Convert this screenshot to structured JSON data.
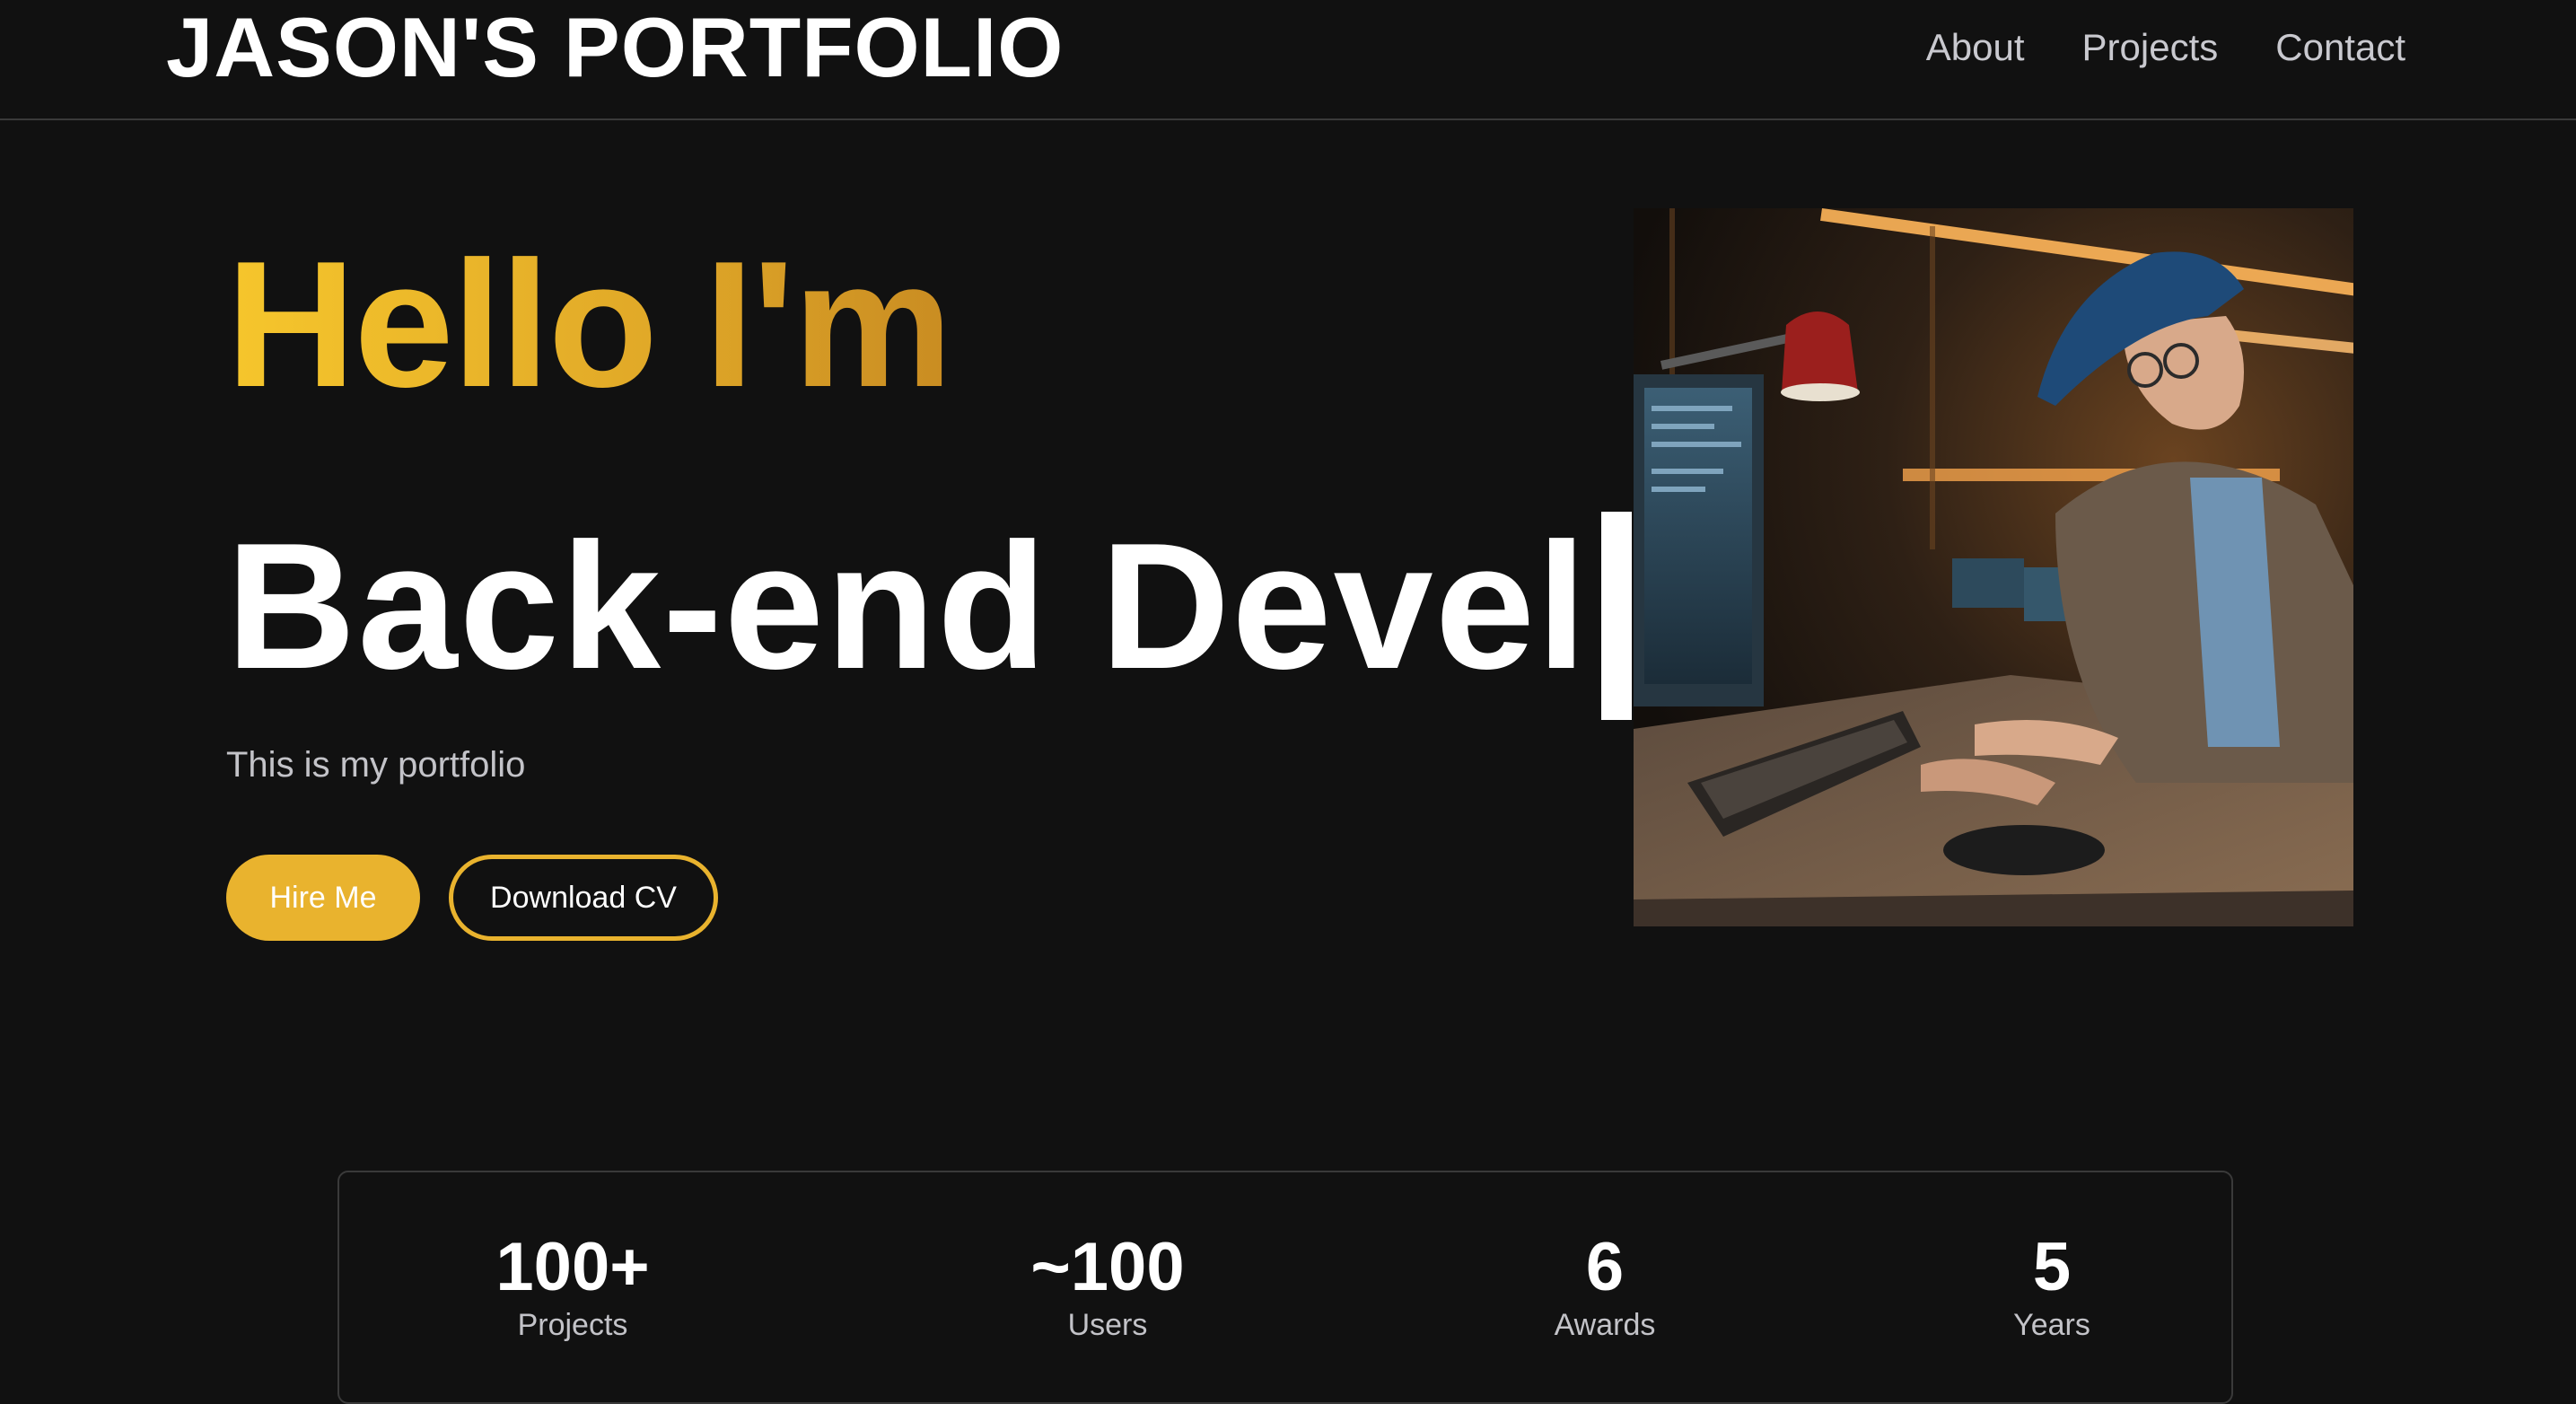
{
  "header": {
    "brand": "JASON'S PORTFOLIO",
    "nav": [
      {
        "label": "About"
      },
      {
        "label": "Projects"
      },
      {
        "label": "Contact"
      }
    ]
  },
  "hero": {
    "greeting": "Hello I'm",
    "role_typed": "Back-end Devel",
    "tagline": "This is my portfolio",
    "hire_label": "Hire Me",
    "cv_label": "Download CV",
    "image_description": "illustration of a developer in a cap and glasses typing at a keyboard in front of monitors"
  },
  "stats": [
    {
      "value": "100+",
      "label": "Projects"
    },
    {
      "value": "~100",
      "label": "Users"
    },
    {
      "value": "6",
      "label": "Awards"
    },
    {
      "value": "5",
      "label": "Years"
    }
  ],
  "colors": {
    "background": "#111111",
    "accent": "#e9b32e",
    "accent_gradient_start": "#f6c62c",
    "accent_gradient_end": "#c98c22",
    "border": "#3a3a3a",
    "muted_text": "#c3c3c8"
  }
}
